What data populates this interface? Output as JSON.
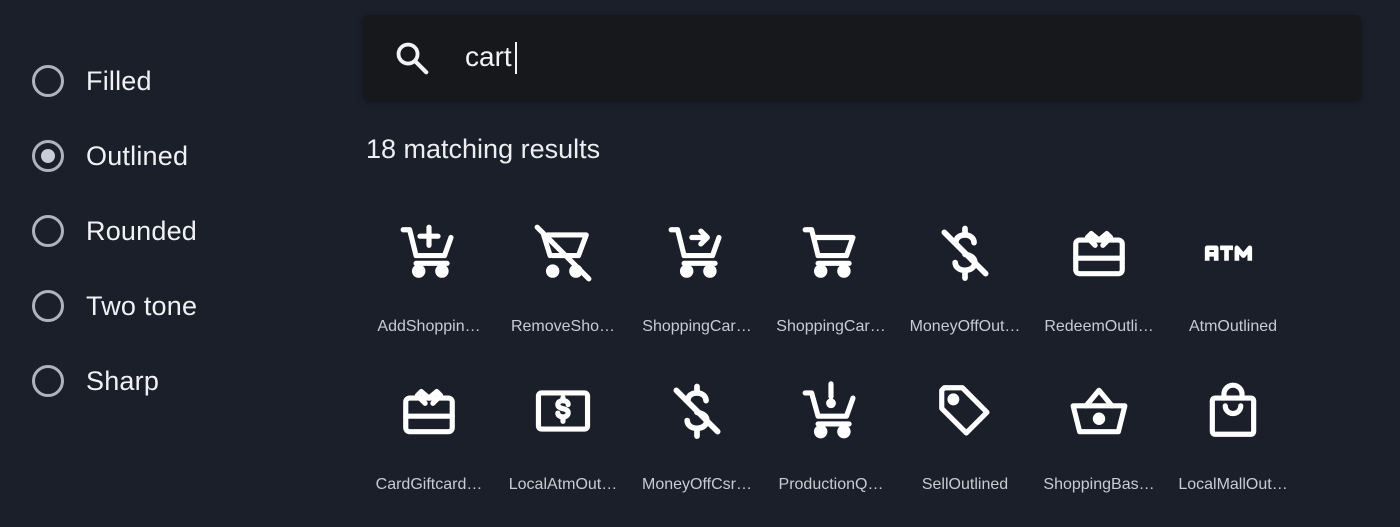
{
  "sidebar": {
    "options": [
      {
        "label": "Filled",
        "selected": false
      },
      {
        "label": "Outlined",
        "selected": true
      },
      {
        "label": "Rounded",
        "selected": false
      },
      {
        "label": "Two tone",
        "selected": false
      },
      {
        "label": "Sharp",
        "selected": false
      }
    ]
  },
  "search": {
    "value": "cart",
    "icon": "search-icon"
  },
  "results": {
    "count_text": "18 matching results"
  },
  "icons": [
    {
      "name": "AddShoppin…",
      "icon": "add-shopping-cart-icon"
    },
    {
      "name": "RemoveSho…",
      "icon": "remove-shopping-cart-icon"
    },
    {
      "name": "ShoppingCar…",
      "icon": "shopping-cart-checkout-icon"
    },
    {
      "name": "ShoppingCar…",
      "icon": "shopping-cart-icon"
    },
    {
      "name": "MoneyOffOut…",
      "icon": "money-off-icon"
    },
    {
      "name": "RedeemOutli…",
      "icon": "redeem-icon"
    },
    {
      "name": "AtmOutlined",
      "icon": "atm-icon"
    },
    {
      "name": "CardGiftcard…",
      "icon": "card-giftcard-icon"
    },
    {
      "name": "LocalAtmOut…",
      "icon": "local-atm-icon"
    },
    {
      "name": "MoneyOffCsr…",
      "icon": "money-off-csred-icon"
    },
    {
      "name": "ProductionQ…",
      "icon": "production-quantity-limits-icon"
    },
    {
      "name": "SellOutlined",
      "icon": "sell-icon"
    },
    {
      "name": "ShoppingBas…",
      "icon": "shopping-basket-icon"
    },
    {
      "name": "LocalMallOut…",
      "icon": "local-mall-icon"
    }
  ]
}
